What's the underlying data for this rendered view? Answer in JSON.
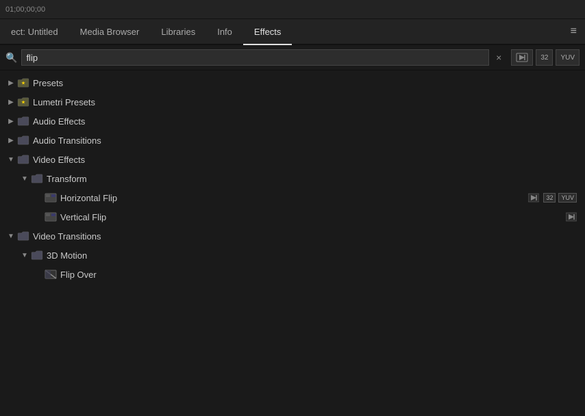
{
  "topbar": {
    "title": "01;00;00;00"
  },
  "tabs": [
    {
      "id": "project",
      "label": "ect: Untitled",
      "active": false
    },
    {
      "id": "media-browser",
      "label": "Media Browser",
      "active": false
    },
    {
      "id": "libraries",
      "label": "Libraries",
      "active": false
    },
    {
      "id": "info",
      "label": "Info",
      "active": false
    },
    {
      "id": "effects",
      "label": "Effects",
      "active": true
    }
  ],
  "menu_icon": "≡",
  "search": {
    "placeholder": "flip",
    "value": "flip",
    "clear_label": "×",
    "btn_accel": "⚡",
    "btn_32": "32",
    "btn_yuv": "YUV"
  },
  "tree": [
    {
      "id": "presets",
      "label": "Presets",
      "type": "folder-star",
      "expanded": false,
      "indent": 1,
      "children": []
    },
    {
      "id": "lumetri-presets",
      "label": "Lumetri Presets",
      "type": "folder-star",
      "expanded": false,
      "indent": 1,
      "children": []
    },
    {
      "id": "audio-effects",
      "label": "Audio Effects",
      "type": "folder",
      "expanded": false,
      "indent": 1,
      "children": []
    },
    {
      "id": "audio-transitions",
      "label": "Audio Transitions",
      "type": "folder",
      "expanded": false,
      "indent": 1,
      "children": []
    },
    {
      "id": "video-effects",
      "label": "Video Effects",
      "type": "folder",
      "expanded": true,
      "indent": 1,
      "children": [
        {
          "id": "transform",
          "label": "Transform",
          "type": "folder",
          "expanded": true,
          "indent": 2,
          "children": [
            {
              "id": "horizontal-flip",
              "label": "Horizontal Flip",
              "type": "effect",
              "indent": 3,
              "tags": [
                "accel",
                "32",
                "yuv"
              ]
            },
            {
              "id": "vertical-flip",
              "label": "Vertical Flip",
              "type": "effect",
              "indent": 3,
              "tags": [
                "accel"
              ]
            }
          ]
        }
      ]
    },
    {
      "id": "video-transitions",
      "label": "Video Transitions",
      "type": "folder",
      "expanded": true,
      "indent": 1,
      "children": [
        {
          "id": "3d-motion",
          "label": "3D Motion",
          "type": "folder",
          "expanded": true,
          "indent": 2,
          "children": [
            {
              "id": "flip-over",
              "label": "Flip Over",
              "type": "transition",
              "indent": 3,
              "tags": []
            }
          ]
        }
      ]
    }
  ]
}
